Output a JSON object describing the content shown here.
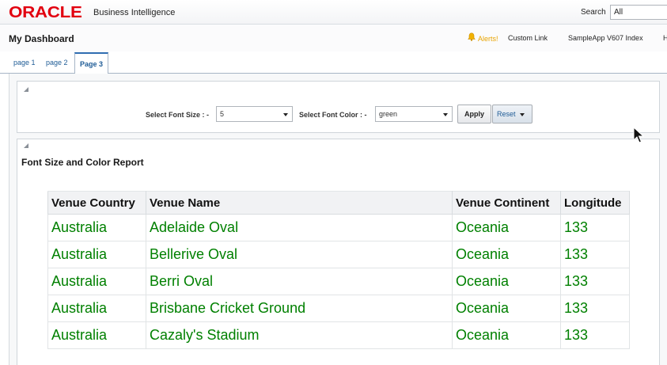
{
  "header": {
    "logo": "ORACLE",
    "product": "Business Intelligence",
    "search_label": "Search",
    "search_scope": "All"
  },
  "dashboard": {
    "title": "My Dashboard",
    "alerts_label": "Alerts!",
    "links": [
      "Custom Link",
      "SampleApp V607 Index",
      "H"
    ]
  },
  "tabs": [
    {
      "label": "page 1",
      "active": false
    },
    {
      "label": "page 2",
      "active": false
    },
    {
      "label": "Page 3",
      "active": true
    }
  ],
  "prompts": {
    "font_size_label": "Select Font Size : -",
    "font_size_value": "5",
    "font_color_label": "Select Font Color : -",
    "font_color_value": "green",
    "apply_label": "Apply",
    "reset_label": "Reset"
  },
  "report": {
    "title": "Font Size and Color Report",
    "text_color": "#008000",
    "columns": [
      "Venue Country",
      "Venue Name",
      "Venue Continent",
      "Longitude"
    ],
    "rows": [
      [
        "Australia",
        "Adelaide Oval",
        "Oceania",
        "133"
      ],
      [
        "Australia",
        "Bellerive Oval",
        "Oceania",
        "133"
      ],
      [
        "Australia",
        "Berri Oval",
        "Oceania",
        "133"
      ],
      [
        "Australia",
        "Brisbane Cricket Ground",
        "Oceania",
        "133"
      ],
      [
        "Australia",
        "Cazaly's Stadium",
        "Oceania",
        "133"
      ]
    ]
  },
  "colors": {
    "oracle_red": "#e2000f",
    "link_blue": "#1f5c96",
    "alert_amber": "#e8a400"
  }
}
